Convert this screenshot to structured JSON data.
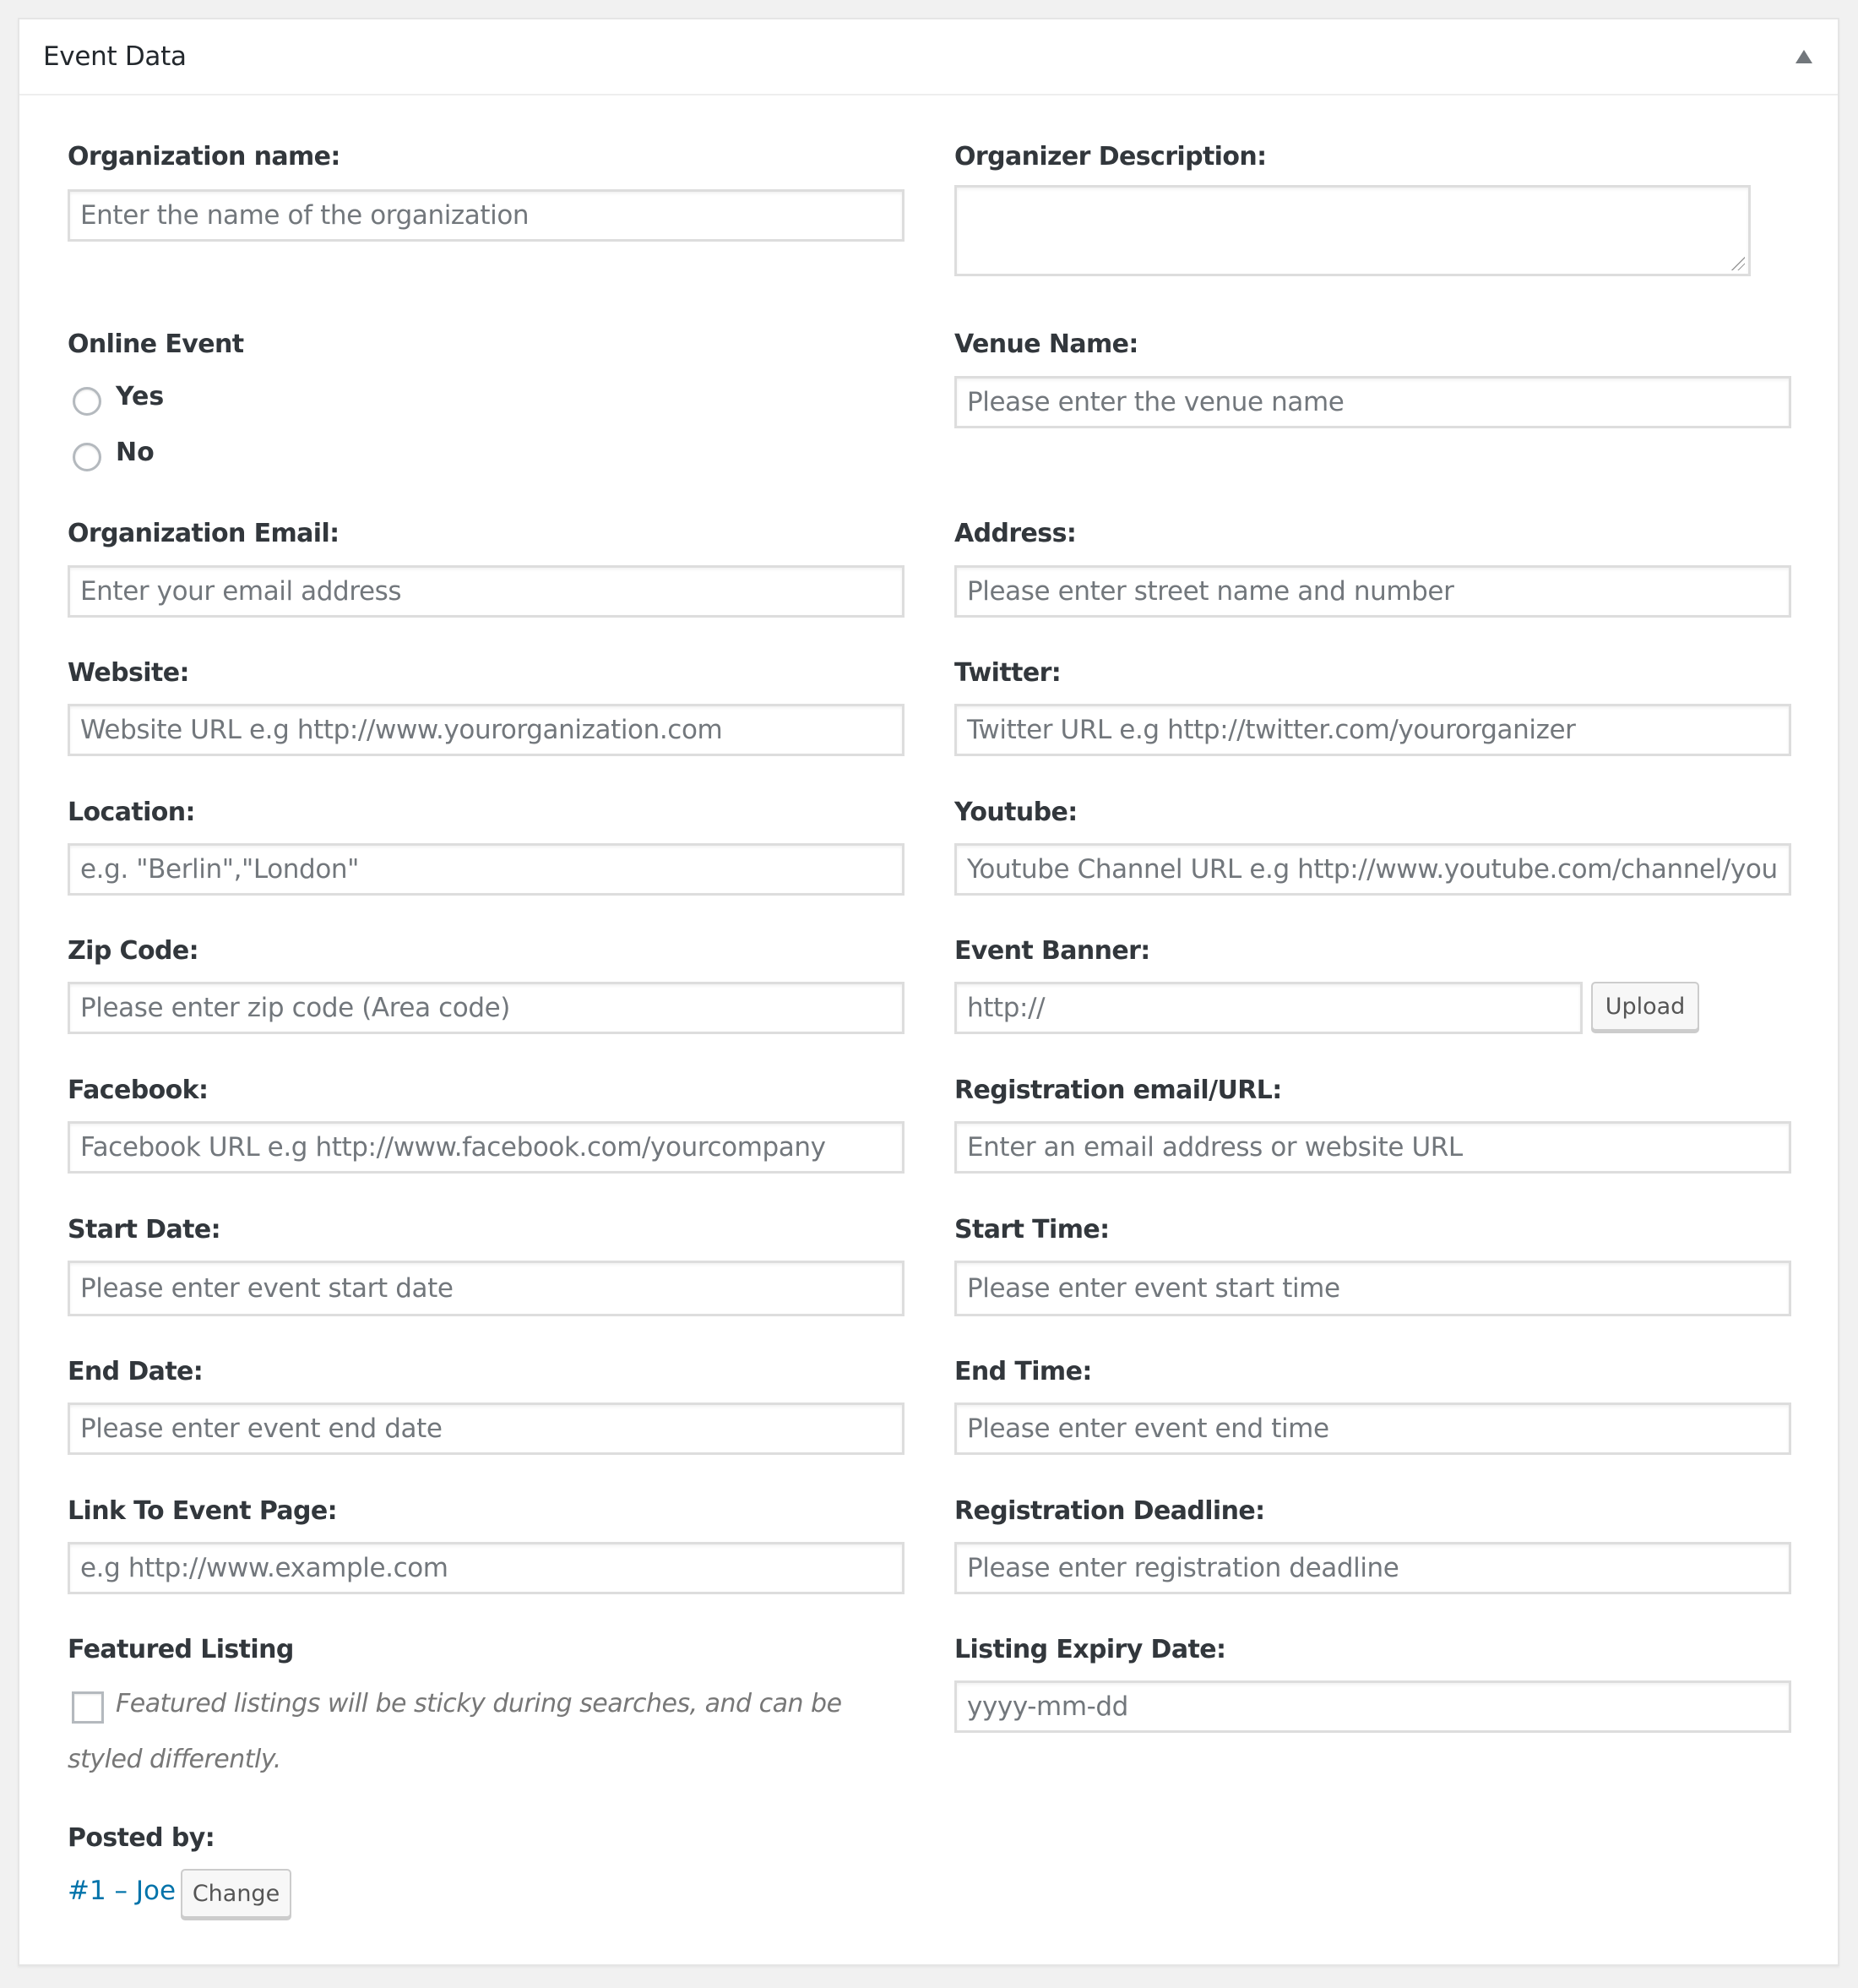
{
  "panel": {
    "title": "Event Data",
    "toggle_icon": "triangle-up-icon"
  },
  "left": {
    "org_name": {
      "label": "Organization name:",
      "placeholder": "Enter the name of the organization"
    },
    "online_event": {
      "label": "Online Event",
      "options": [
        "Yes",
        "No"
      ]
    },
    "org_email": {
      "label": "Organization Email:",
      "placeholder": "Enter your email address"
    },
    "website": {
      "label": "Website:",
      "placeholder": "Website URL e.g http://www.yourorganization.com"
    },
    "location": {
      "label": "Location:",
      "placeholder": "e.g. \"Berlin\",\"London\""
    },
    "zip": {
      "label": "Zip Code:",
      "placeholder": "Please enter zip code (Area code)"
    },
    "facebook": {
      "label": "Facebook:",
      "placeholder": "Facebook URL e.g http://www.facebook.com/yourcompany"
    },
    "start_date": {
      "label": "Start Date:",
      "placeholder": "Please enter event start date"
    },
    "end_date": {
      "label": "End Date:",
      "placeholder": "Please enter event end date"
    },
    "link": {
      "label": "Link To Event Page:",
      "placeholder": "e.g http://www.example.com"
    },
    "featured": {
      "label": "Featured Listing",
      "description": "Featured listings will be sticky during searches, and can be styled differently."
    },
    "posted_by": {
      "label": "Posted by:",
      "user": "#1 – Joe",
      "change_label": "Change"
    }
  },
  "right": {
    "org_desc": {
      "label": "Organizer Description:"
    },
    "venue": {
      "label": "Venue Name:",
      "placeholder": "Please enter the venue name"
    },
    "address": {
      "label": "Address:",
      "placeholder": "Please enter street name and number"
    },
    "twitter": {
      "label": "Twitter:",
      "placeholder": "Twitter URL e.g http://twitter.com/yourorganizer"
    },
    "youtube": {
      "label": "Youtube:",
      "placeholder": "Youtube Channel URL e.g http://www.youtube.com/channel/you"
    },
    "banner": {
      "label": "Event Banner:",
      "placeholder": "http://",
      "upload_label": "Upload"
    },
    "registration": {
      "label": "Registration email/URL:",
      "placeholder": "Enter an email address or website URL"
    },
    "start_time": {
      "label": "Start Time:",
      "placeholder": "Please enter event start time"
    },
    "end_time": {
      "label": "End Time:",
      "placeholder": "Please enter event end time"
    },
    "deadline": {
      "label": "Registration Deadline:",
      "placeholder": "Please enter registration deadline"
    },
    "expiry": {
      "label": "Listing Expiry Date:",
      "placeholder": "yyyy-mm-dd"
    }
  }
}
